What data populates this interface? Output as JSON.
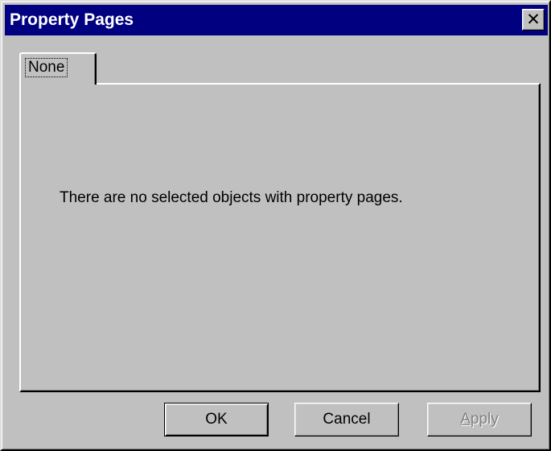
{
  "window": {
    "title": "Property Pages"
  },
  "tabs": [
    {
      "label": "None"
    }
  ],
  "panel": {
    "message": "There are no selected objects with property pages."
  },
  "buttons": {
    "ok_label": "OK",
    "cancel_label": "Cancel",
    "apply_label_rest": "pply",
    "apply_label_access": "A"
  },
  "colors": {
    "titlebar": "#000080",
    "face": "#c0c0c0",
    "disabled_text": "#808080"
  },
  "icons": {
    "close": "close-icon"
  }
}
